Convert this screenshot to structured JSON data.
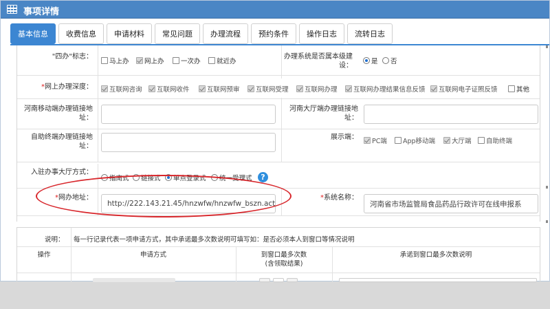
{
  "window": {
    "title": "事项详情"
  },
  "tabs": [
    {
      "label": "基本信息",
      "active": true
    },
    {
      "label": "收费信息"
    },
    {
      "label": "申请材料"
    },
    {
      "label": "常见问题"
    },
    {
      "label": "办理流程"
    },
    {
      "label": "预约条件"
    },
    {
      "label": "操作日志"
    },
    {
      "label": "流转日志"
    }
  ],
  "form": {
    "sibian": {
      "label": "\"四办\"标志：",
      "options": [
        {
          "label": "马上办",
          "checked": false
        },
        {
          "label": "网上办",
          "checked": true
        },
        {
          "label": "一次办",
          "checked": false
        },
        {
          "label": "就近办",
          "checked": false
        }
      ]
    },
    "own_system": {
      "label": "办理系统是否属本级建设：",
      "options": [
        {
          "label": "是",
          "selected": true
        },
        {
          "label": "否",
          "selected": false
        }
      ]
    },
    "online_depth": {
      "label": "网上办理深度：",
      "options": [
        {
          "label": "互联网咨询",
          "checked": true
        },
        {
          "label": "互联网收件",
          "checked": true
        },
        {
          "label": "互联网预审",
          "checked": true
        },
        {
          "label": "互联网受理",
          "checked": true
        },
        {
          "label": "互联网办理",
          "checked": true
        },
        {
          "label": "互联网办理结果信息反馈",
          "checked": true
        },
        {
          "label": "互联网电子证照反馈",
          "checked": true
        },
        {
          "label": "其他",
          "checked": false
        }
      ]
    },
    "mobile_link": {
      "label": "河南移动端办理链接地址：",
      "value": ""
    },
    "hall_link": {
      "label": "河南大厅端办理链接地址：",
      "value": ""
    },
    "selfservice_link": {
      "label": "自助终端办理链接地址：",
      "value": ""
    },
    "display_end": {
      "label": "展示端：",
      "options": [
        {
          "label": "PC端",
          "checked": true
        },
        {
          "label": "App移动端",
          "checked": false
        },
        {
          "label": "大厅端",
          "checked": true
        },
        {
          "label": "自助终端",
          "checked": false
        }
      ]
    },
    "hall_mode": {
      "label": "入驻办事大厅方式：",
      "options": [
        {
          "label": "指南式",
          "selected": false
        },
        {
          "label": "链接式",
          "selected": false
        },
        {
          "label": "单点登录式",
          "selected": true
        },
        {
          "label": "统一受理式",
          "selected": false
        }
      ],
      "help_icon": "?"
    },
    "web_address": {
      "label": "网办地址：",
      "value": "http://222.143.21.45/hnzwfw/hnzwfw_bszn.actio"
    },
    "system_name": {
      "label": "系统名称：",
      "value": "河南省市场监管局食品药品行政许可在线申报系"
    }
  },
  "notes_table": {
    "label": "说明：",
    "text": "每一行记录代表一项申请方式，其中承诺最多次数说明可填写如：是否必须本人到窗口等情况说明",
    "headers": {
      "op": "操作",
      "method": "申请方式",
      "max_visits": "到窗口最多次数",
      "max_visits_sub": "(含领取结果)",
      "promise": "承诺到窗口最多次数说明"
    }
  },
  "colors": {
    "accent": "#3c86d2",
    "title_bar": "#4a86c5",
    "highlight": "#d8262b"
  },
  "icons": {
    "title": "grid-icon",
    "help": "help-icon"
  }
}
